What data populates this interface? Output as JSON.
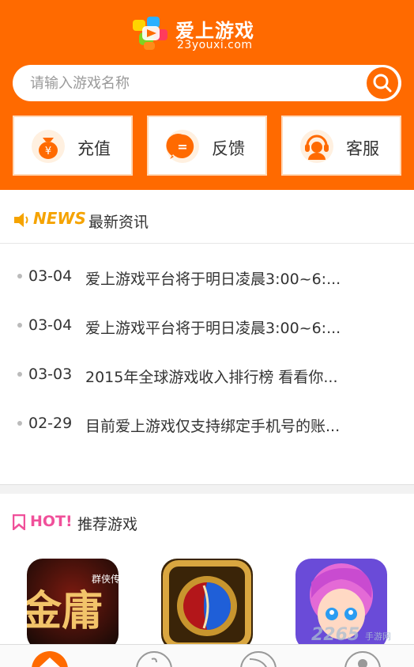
{
  "header": {
    "app_name": "爱上游戏",
    "domain": "23youxi.com"
  },
  "search": {
    "placeholder": "请输入游戏名称"
  },
  "quick_actions": [
    {
      "label": "充值",
      "icon": "money-bag-icon",
      "glyph": "¥"
    },
    {
      "label": "反馈",
      "icon": "chat-bubble-icon",
      "glyph": "="
    },
    {
      "label": "客服",
      "icon": "headset-icon"
    }
  ],
  "news": {
    "badge": "NEWS",
    "title": "最新资讯",
    "items": [
      {
        "date": "03-04",
        "text": "爱上游戏平台将于明日凌晨3:00~6:..."
      },
      {
        "date": "03-04",
        "text": "爱上游戏平台将于明日凌晨3:00~6:..."
      },
      {
        "date": "03-03",
        "text": "2015年全球游戏收入排行榜 看看你..."
      },
      {
        "date": "02-29",
        "text": "目前爱上游戏仅支持绑定手机号的账..."
      }
    ]
  },
  "hot": {
    "badge": "HOT!",
    "title": "推荐游戏",
    "games": [
      {
        "name": "金庸群侠传",
        "art_text_main": "金庸",
        "art_text_side": "群侠传"
      },
      {
        "name": "orb-game"
      },
      {
        "name": "hero-girl-game"
      }
    ]
  },
  "watermark": {
    "main": "2265",
    "small": "手游网"
  },
  "colors": {
    "brand": "#ff6a00",
    "news_badge": "#f5a300",
    "hot_badge": "#f0509a"
  }
}
